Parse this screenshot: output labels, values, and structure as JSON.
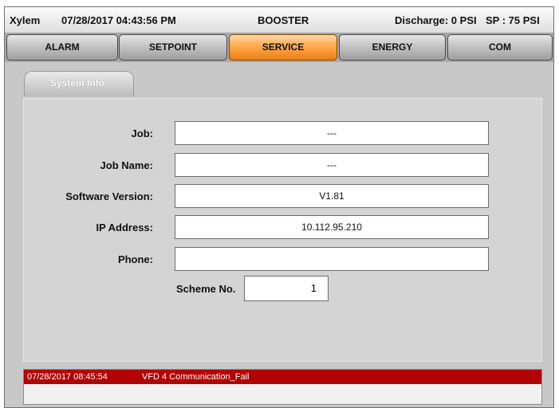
{
  "titlebar": {
    "brand": "Xylem",
    "datetime": "07/28/2017 04:43:56 PM",
    "mode": "BOOSTER",
    "discharge": "Discharge: 0 PSI",
    "setpoint": "SP : 75 PSI"
  },
  "nav": {
    "tabs": [
      {
        "label": "ALARM"
      },
      {
        "label": "SETPOINT"
      },
      {
        "label": "SERVICE"
      },
      {
        "label": "ENERGY"
      },
      {
        "label": "COM"
      }
    ],
    "active": "SERVICE"
  },
  "subtab": {
    "label": "System Info"
  },
  "form": {
    "job": {
      "label": "Job:",
      "value": "---"
    },
    "job_name": {
      "label": "Job Name:",
      "value": "---"
    },
    "software_version": {
      "label": "Software Version:",
      "value": "V1.81"
    },
    "ip_address": {
      "label": "IP Address:",
      "value": "10.112.95.210"
    },
    "phone": {
      "label": "Phone:",
      "value": ""
    },
    "scheme": {
      "label": "Scheme No.",
      "value": "1"
    }
  },
  "alarm": {
    "time": "07/28/2017 08:45:54",
    "message": "VFD 4 Communication_Fail"
  },
  "colors": {
    "active_tab": "#ff9a2e",
    "alarm_bg": "#b30000"
  }
}
